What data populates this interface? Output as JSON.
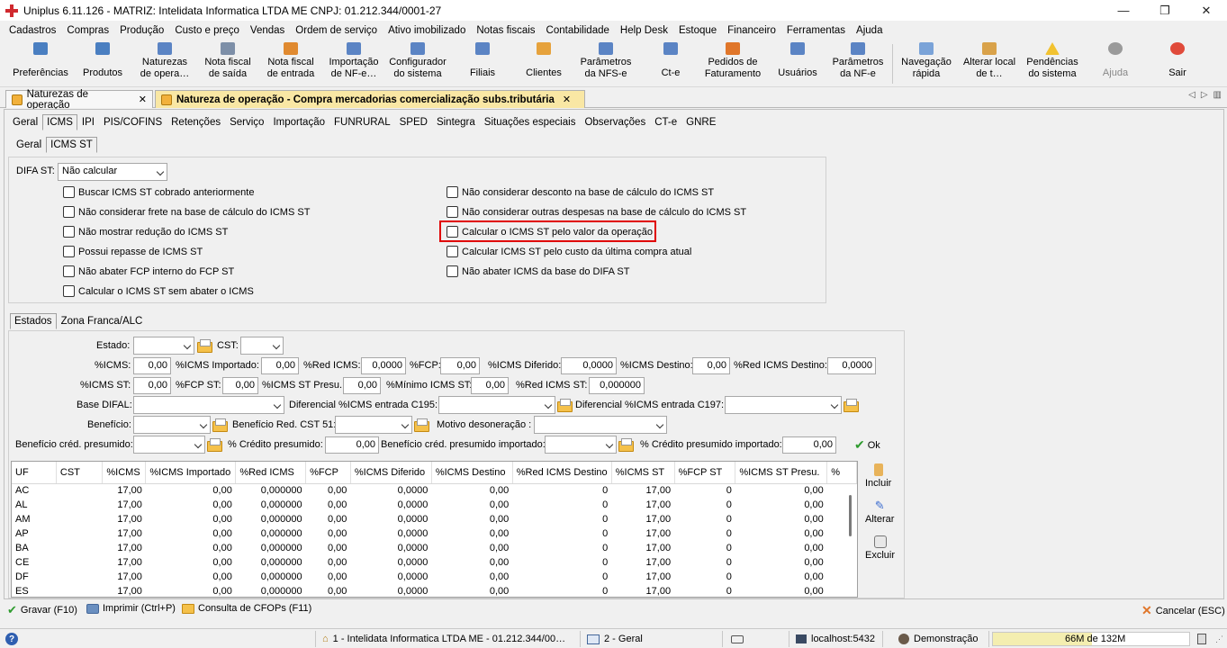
{
  "window": {
    "title": "Uniplus 6.11.126 - MATRIZ: Intelidata Informatica LTDA ME CNPJ: 01.212.344/0001-27",
    "minimize": "—",
    "restore": "❐",
    "close": "✕"
  },
  "menu": [
    "Cadastros",
    "Compras",
    "Produção",
    "Custo e preço",
    "Vendas",
    "Ordem de serviço",
    "Ativo imobilizado",
    "Notas fiscais",
    "Contabilidade",
    "Help Desk",
    "Estoque",
    "Financeiro",
    "Ferramentas",
    "Ajuda"
  ],
  "toolbar": {
    "items": [
      {
        "label": "Preferências",
        "icon": "preferences-icon",
        "color": "#4a7fc1"
      },
      {
        "label": "Produtos",
        "icon": "products-icon",
        "color": "#4a7fc1"
      },
      {
        "label": "Naturezas de opera…",
        "icon": "naturezas-icon",
        "color": "#5b84c4"
      },
      {
        "label": "Nota fiscal de saída",
        "icon": "nota-saida-icon",
        "color": "#7d8fa8"
      },
      {
        "label": "Nota fiscal de entrada",
        "icon": "nota-entrada-icon",
        "color": "#e08a30"
      },
      {
        "label": "Importação de NF-e…",
        "icon": "import-nfe-icon",
        "color": "#5b84c4"
      },
      {
        "label": "Configurador do sistema",
        "icon": "config-icon",
        "color": "#5b84c4"
      },
      {
        "label": "Filiais",
        "icon": "filiais-icon",
        "color": "#5b84c4"
      },
      {
        "label": "Clientes",
        "icon": "clientes-icon",
        "color": "#e6a23c"
      },
      {
        "label": "Parâmetros da NFS-e",
        "icon": "param-nfse-icon",
        "color": "#5b84c4"
      },
      {
        "label": "Ct-e",
        "icon": "cte-icon",
        "color": "#5b84c4"
      },
      {
        "label": "Pedidos de Faturamento",
        "icon": "pedidos-icon",
        "color": "#e0762a"
      },
      {
        "label": "Usuários",
        "icon": "usuarios-icon",
        "color": "#5b84c4"
      },
      {
        "label": "Parâmetros da NF-e",
        "icon": "param-nfe-icon",
        "color": "#5b84c4"
      },
      {
        "label": "Navegação rápida",
        "icon": "navegacao-icon",
        "color": "#7aa3d8"
      },
      {
        "label": "Alterar local de t…",
        "icon": "home-icon",
        "color": "#d9a24a"
      },
      {
        "label": "Pendências do sistema",
        "icon": "warning-icon",
        "color": "#f2c230"
      },
      {
        "label": "Ajuda",
        "icon": "help-icon",
        "color": "#9a9a9a"
      },
      {
        "label": "Sair",
        "icon": "power-icon",
        "color": "#e04a3a"
      }
    ]
  },
  "doctabs": {
    "tab1": "Naturezas de operação",
    "tab2": "Natureza de operação - Compra mercadorias comercialização subs.tributária",
    "close": "✕"
  },
  "main_tabs": [
    "Geral",
    "ICMS",
    "IPI",
    "PIS/COFINS",
    "Retenções",
    "Serviço",
    "Importação",
    "FUNRURAL",
    "SPED",
    "Sintegra",
    "Situações especiais",
    "Observações",
    "CT-e",
    "GNRE"
  ],
  "sub_tabs": [
    "Geral",
    "ICMS ST"
  ],
  "difa": {
    "label": "DIFA ST:",
    "value": "Não calcular"
  },
  "checks_left": [
    "Buscar ICMS ST cobrado anteriormente",
    "Não considerar frete na base de cálculo do ICMS ST",
    "Não mostrar redução do ICMS ST",
    "Possui repasse de ICMS ST",
    "Não abater FCP interno do FCP ST",
    "Calcular o ICMS ST sem abater o ICMS"
  ],
  "checks_right": [
    "Não considerar desconto na base de cálculo do ICMS ST",
    "Não considerar outras despesas na base de cálculo do ICMS ST",
    "Calcular o ICMS ST pelo valor da operação",
    "Calcular ICMS ST pelo custo da última compra atual",
    "Não abater ICMS da base do DIFA ST"
  ],
  "lower_tabs": [
    "Estados",
    "Zona Franca/ALC"
  ],
  "form": {
    "estado": "Estado:",
    "cst": "CST:",
    "icms": "%ICMS:",
    "icms_v": "0,00",
    "icms_imp": "%ICMS Importado:",
    "icms_imp_v": "0,00",
    "red_icms": "%Red ICMS:",
    "red_icms_v": "0,0000",
    "fcp": "%FCP:",
    "fcp_v": "0,00",
    "icms_dif": "%ICMS Diferido:",
    "icms_dif_v": "0,0000",
    "icms_dest": "%ICMS Destino:",
    "icms_dest_v": "0,00",
    "red_icms_dest": "%Red ICMS Destino:",
    "red_icms_dest_v": "0,0000",
    "icms_st": "%ICMS ST:",
    "icms_st_v": "0,00",
    "fcp_st": "%FCP ST:",
    "fcp_st_v": "0,00",
    "icms_st_presu": "%ICMS ST Presu.:",
    "icms_st_presu_v": "0,00",
    "minimo": "%Mínimo ICMS ST:",
    "minimo_v": "0,00",
    "red_icms_st": "%Red ICMS ST:",
    "red_icms_st_v": "0,000000",
    "base_difal": "Base DIFAL:",
    "dif195": "Diferencial %ICMS entrada C195:",
    "dif197": "Diferencial %ICMS entrada C197:",
    "beneficio": "Benefício:",
    "benef_red": "Benefício Red. CST 51:",
    "motivo": "Motivo desoneração :",
    "benef_cred": "Benefício créd. presumido:",
    "cred_pres": "% Crédito presumido:",
    "cred_pres_v": "0,00",
    "benef_cred_imp": "Benefício créd. presumido importado:",
    "cred_pres_imp": "% Crédito presumido importado:",
    "cred_pres_imp_v": "0,00",
    "ok": "Ok"
  },
  "grid": {
    "columns": [
      "UF",
      "CST",
      "%ICMS",
      "%ICMS Importado",
      "%Red ICMS",
      "%FCP",
      "%ICMS Diferido",
      "%ICMS Destino",
      "%Red ICMS Destino",
      "%ICMS ST",
      "%FCP ST",
      "%ICMS ST Presu.",
      "%"
    ],
    "rows": [
      [
        "AC",
        "",
        "17,00",
        "0,00",
        "0,000000",
        "0,00",
        "0,0000",
        "0,00",
        "0",
        "17,00",
        "0",
        "0,00"
      ],
      [
        "AL",
        "",
        "17,00",
        "0,00",
        "0,000000",
        "0,00",
        "0,0000",
        "0,00",
        "0",
        "17,00",
        "0",
        "0,00"
      ],
      [
        "AM",
        "",
        "17,00",
        "0,00",
        "0,000000",
        "0,00",
        "0,0000",
        "0,00",
        "0",
        "17,00",
        "0",
        "0,00"
      ],
      [
        "AP",
        "",
        "17,00",
        "0,00",
        "0,000000",
        "0,00",
        "0,0000",
        "0,00",
        "0",
        "17,00",
        "0",
        "0,00"
      ],
      [
        "BA",
        "",
        "17,00",
        "0,00",
        "0,000000",
        "0,00",
        "0,0000",
        "0,00",
        "0",
        "17,00",
        "0",
        "0,00"
      ],
      [
        "CE",
        "",
        "17,00",
        "0,00",
        "0,000000",
        "0,00",
        "0,0000",
        "0,00",
        "0",
        "17,00",
        "0",
        "0,00"
      ],
      [
        "DF",
        "",
        "17,00",
        "0,00",
        "0,000000",
        "0,00",
        "0,0000",
        "0,00",
        "0",
        "17,00",
        "0",
        "0,00"
      ],
      [
        "ES",
        "",
        "17,00",
        "0,00",
        "0,000000",
        "0,00",
        "0,0000",
        "0,00",
        "0",
        "17,00",
        "0",
        "0,00"
      ]
    ]
  },
  "side_actions": {
    "incluir": "Incluir",
    "alterar": "Alterar",
    "excluir": "Excluir"
  },
  "bottom": {
    "gravar": "Gravar (F10)",
    "imprimir": "Imprimir (Ctrl+P)",
    "cfops": "Consulta de CFOPs (F11)",
    "cancelar": "Cancelar (ESC)"
  },
  "status": {
    "company": "1 - Intelidata Informatica LTDA ME - 01.212.344/00…",
    "section": "2 - Geral",
    "server": "localhost:5432",
    "user": "Demonstração",
    "memory": "66M de 132M"
  },
  "colors": {
    "highlight": "#e00000",
    "active_tab": "#f9e7a4",
    "memory_bar": "#f4eeb0"
  }
}
